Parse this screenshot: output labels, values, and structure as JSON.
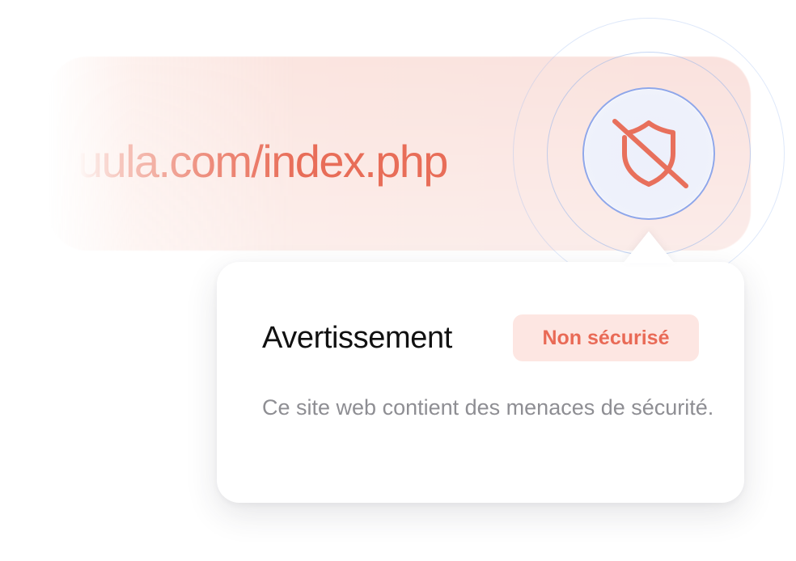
{
  "address_bar": {
    "url_text": "uula.com/index.php"
  },
  "security_indicator": {
    "icon": "shield-off-icon",
    "icon_color": "#e8705c",
    "ring_color": "#8fa7ea"
  },
  "popover": {
    "title": "Avertissement",
    "badge": "Non sécurisé",
    "message": "Ce site web contient des menaces de sécurité."
  },
  "colors": {
    "accent_red": "#e96a56",
    "badge_background": "#fde6e2",
    "title_text": "#111111",
    "body_text": "#8e8e93"
  }
}
